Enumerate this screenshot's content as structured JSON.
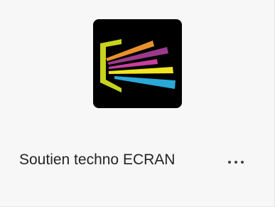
{
  "team": {
    "name": "Soutien techno ECRAN",
    "icon": "ecran-logo-icon",
    "more_icon": "more-options-icon"
  },
  "colors": {
    "card_background": "#f7f7f7",
    "logo_background": "#000000",
    "logo_frame": "#c8d41c",
    "logo_ray_orange": "#e8912c",
    "logo_ray_purple": "#9b3a8c",
    "logo_ray_magenta": "#c4409a",
    "logo_ray_yellow": "#f2e51f",
    "logo_ray_cyan": "#29a9d8",
    "text": "#242424"
  }
}
